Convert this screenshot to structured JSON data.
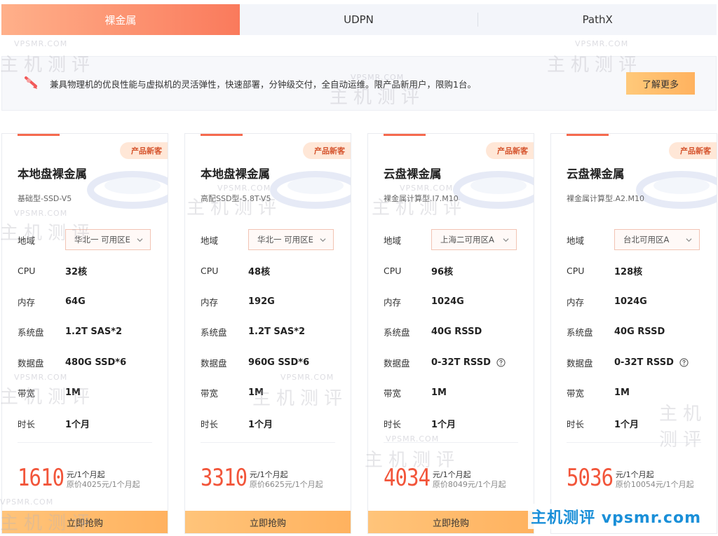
{
  "tabs": [
    {
      "label": "裸金属",
      "active": true
    },
    {
      "label": "UDPN",
      "active": false
    },
    {
      "label": "PathX",
      "active": false
    }
  ],
  "banner": {
    "text": "兼具物理机的优良性能与虚拟机的灵活弹性，快速部署，分钟级交付，全自动运维。限产品新用户，限购1台。",
    "more_label": "了解更多"
  },
  "spec_labels": {
    "region": "地域",
    "cpu": "CPU",
    "memory": "内存",
    "system_disk": "系统盘",
    "data_disk": "数据盘",
    "bandwidth": "带宽",
    "duration": "时长"
  },
  "cards": [
    {
      "badge": "产品新客",
      "title": "本地盘裸金属",
      "subtitle": "基础型-SSD-V5",
      "region": "华北一 可用区E",
      "cpu": "32核",
      "memory": "64G",
      "system_disk": "1.2T SAS*2",
      "data_disk": "480G SSD*6",
      "bandwidth": "1M",
      "duration": "1个月",
      "price": "1610",
      "price_unit": "元/1个月起",
      "price_original": "原价4025元/1个月起",
      "buy_label": "立即抢购"
    },
    {
      "badge": "产品新客",
      "title": "本地盘裸金属",
      "subtitle": "高配SSD型-5.8T-V5",
      "region": "华北一 可用区E",
      "cpu": "48核",
      "memory": "192G",
      "system_disk": "1.2T SAS*2",
      "data_disk": "960G SSD*6",
      "bandwidth": "1M",
      "duration": "1个月",
      "price": "3310",
      "price_unit": "元/1个月起",
      "price_original": "原价6625元/1个月起",
      "buy_label": "立即抢购"
    },
    {
      "badge": "产品新客",
      "title": "云盘裸金属",
      "subtitle": "裸金属计算型.I7.M10",
      "region": "上海二可用区A",
      "cpu": "96核",
      "memory": "1024G",
      "system_disk": "40G RSSD",
      "data_disk": "0-32T RSSD",
      "bandwidth": "1M",
      "duration": "1个月",
      "price": "4034",
      "price_unit": "元/1个月起",
      "price_original": "原价8049元/1个月起",
      "buy_label": "立即抢购"
    },
    {
      "badge": "产品新客",
      "title": "云盘裸金属",
      "subtitle": "裸金属计算型.A2.M10",
      "region": "台北可用区A",
      "cpu": "128核",
      "memory": "1024G",
      "system_disk": "40G RSSD",
      "data_disk": "0-32T RSSD",
      "bandwidth": "1M",
      "duration": "1个月",
      "price": "5036",
      "price_unit": "元/1个月起",
      "price_original": "原价10054元/1个月起",
      "buy_label": ""
    }
  ],
  "watermark": {
    "text": "主机测评",
    "domain": "VPSMR.COM",
    "site_mark": "主机测评 vpsmr.com"
  },
  "colors": {
    "accent": "#f2553a",
    "tab_active": "#fa7a5c",
    "button": "#ffb25f",
    "site_mark": "#1a8fd8"
  }
}
